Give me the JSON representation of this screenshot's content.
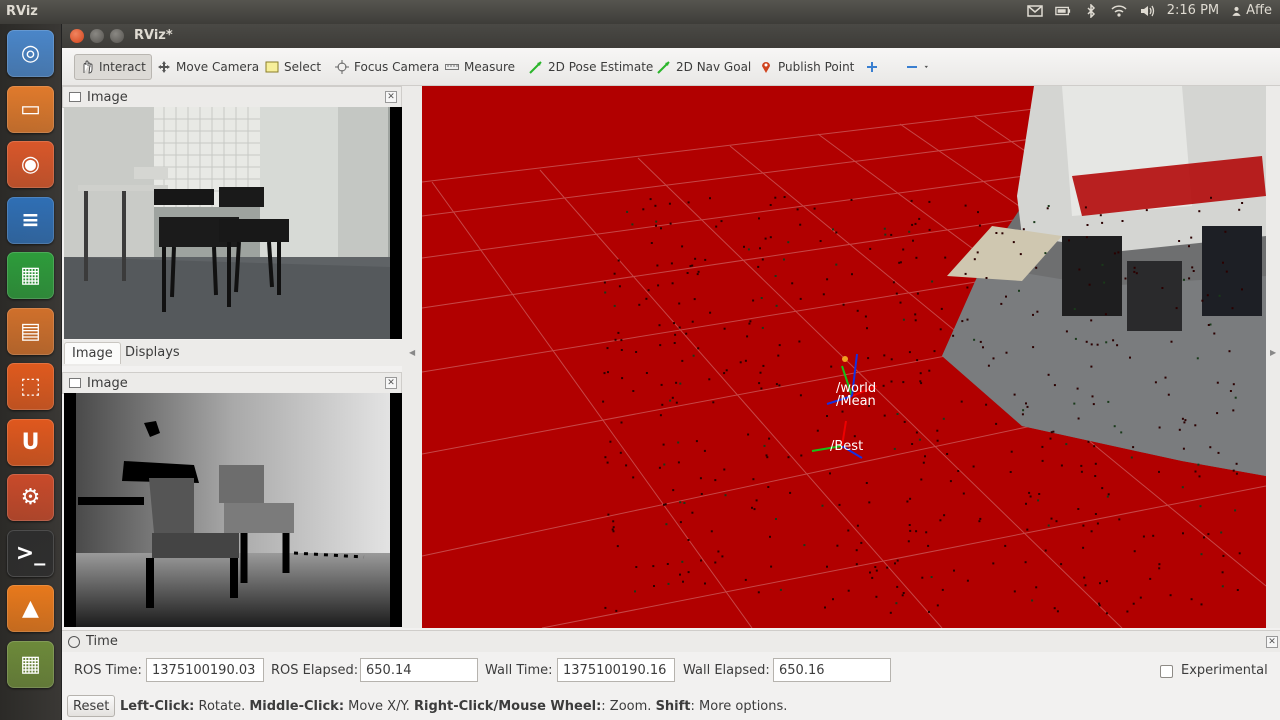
{
  "top_panel": {
    "app_name": "RViz",
    "clock": "2:16 PM",
    "user": "Affe",
    "icons": [
      "mail-icon",
      "battery-icon",
      "bluetooth-icon",
      "wifi-icon",
      "volume-icon",
      "user-icon"
    ]
  },
  "launcher": {
    "items": [
      {
        "name": "dash-home-icon",
        "color": "#4a86c9"
      },
      {
        "name": "files-icon",
        "color": "#e07a2c"
      },
      {
        "name": "firefox-icon",
        "color": "#d9572a"
      },
      {
        "name": "writer-icon",
        "color": "#2f6fb5"
      },
      {
        "name": "calc-icon",
        "color": "#2d9c3b"
      },
      {
        "name": "impress-icon",
        "color": "#d0702b"
      },
      {
        "name": "software-center-icon",
        "color": "#e05a1e"
      },
      {
        "name": "ubuntu-one-icon",
        "color": "#e0581e"
      },
      {
        "name": "system-settings-icon",
        "color": "#c94a2a"
      },
      {
        "name": "terminal-icon",
        "color": "#2d2d2d"
      },
      {
        "name": "vlc-icon",
        "color": "#e8791c"
      },
      {
        "name": "workspace-switcher-icon",
        "color": "#6d8a3a"
      }
    ]
  },
  "window": {
    "title": "RViz*"
  },
  "toolbar": {
    "interact": "Interact",
    "move_camera": "Move Camera",
    "select": "Select",
    "focus_camera": "Focus Camera",
    "measure": "Measure",
    "pose_estimate": "2D Pose Estimate",
    "nav_goal": "2D Nav Goal",
    "publish_point": "Publish Point"
  },
  "panels": {
    "image_top_title": "Image",
    "image_bottom_title": "Image",
    "tabs": [
      "Image",
      "Displays"
    ]
  },
  "view3d": {
    "frame_labels": [
      "/world",
      "/Mean",
      "/Best"
    ],
    "background_color": "#b10000"
  },
  "time_panel": {
    "title": "Time",
    "ros_time_label": "ROS Time:",
    "ros_time": "1375100190.03",
    "ros_elapsed_label": "ROS Elapsed:",
    "ros_elapsed": "650.14",
    "wall_time_label": "Wall Time:",
    "wall_time": "1375100190.16",
    "wall_elapsed_label": "Wall Elapsed:",
    "wall_elapsed": "650.16",
    "experimental_label": "Experimental",
    "experimental_checked": false
  },
  "status": {
    "reset_label": "Reset",
    "hint_1_key": "Left-Click:",
    "hint_1_text": " Rotate. ",
    "hint_2_key": "Middle-Click:",
    "hint_2_text": " Move X/Y. ",
    "hint_3_key": "Right-Click/Mouse Wheel:",
    "hint_3_text": ": Zoom. ",
    "hint_4_key": "Shift",
    "hint_4_text": ": More options."
  }
}
